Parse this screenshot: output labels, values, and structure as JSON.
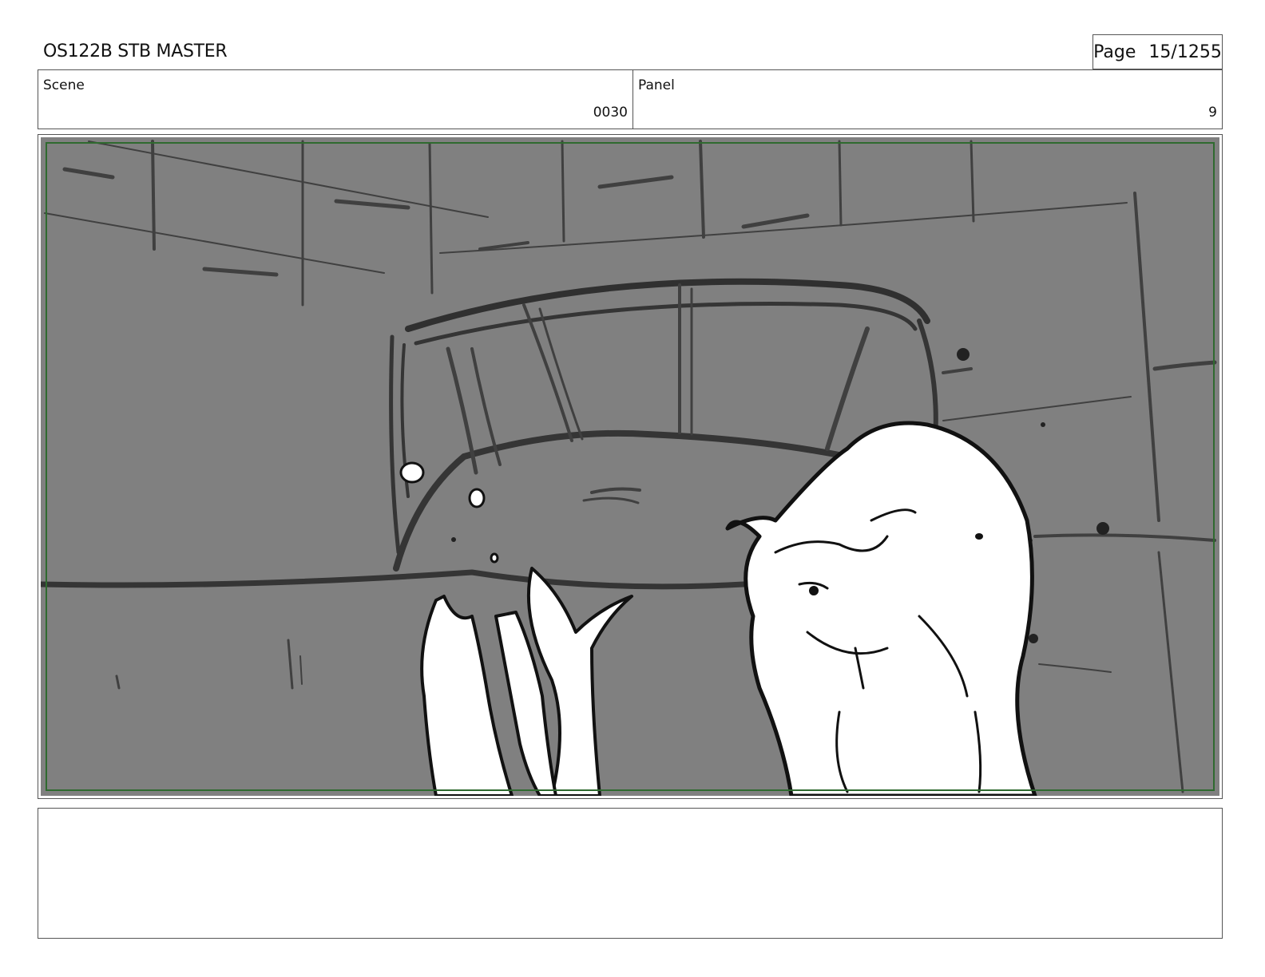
{
  "header": {
    "title": "OS122B STB MASTER",
    "page_label": "Page",
    "page_number": "15/1255"
  },
  "info": {
    "scene_label": "Scene",
    "scene_value": "0030",
    "panel_label": "Panel",
    "panel_value": "9"
  },
  "frame": {
    "background_color": "#808080",
    "safe_area_color": "#2f6a2f"
  },
  "notes": {
    "text": ""
  }
}
